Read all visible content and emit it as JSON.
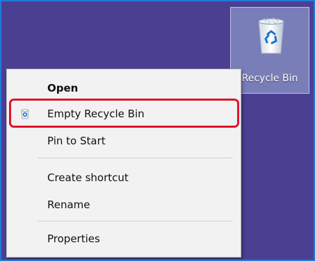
{
  "desktop": {
    "background_color": "#4b3f92",
    "icon": {
      "label": "Recycle Bin",
      "icon_name": "recycle-bin-icon",
      "selected": true
    }
  },
  "context_menu": {
    "items": [
      {
        "label": "Open",
        "bold": true,
        "icon_name": null
      },
      {
        "label": "Empty Recycle Bin",
        "bold": false,
        "icon_name": "recycle-bin-small-icon",
        "highlighted": true
      },
      {
        "label": "Pin to Start",
        "bold": false,
        "icon_name": null
      },
      {
        "label": "Create shortcut",
        "bold": false,
        "icon_name": null
      },
      {
        "label": "Rename",
        "bold": false,
        "icon_name": null
      },
      {
        "label": "Properties",
        "bold": false,
        "icon_name": null
      }
    ],
    "highlight_color": "#e0142b"
  }
}
